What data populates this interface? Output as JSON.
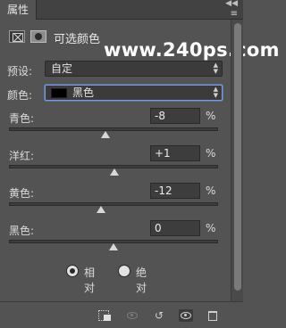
{
  "panel": {
    "tab_label": "属性",
    "collapse_glyph": "◀◀",
    "menu_glyph": "≡"
  },
  "header": {
    "title": "可选颜色",
    "adjustment_icon": "selective-color-icon",
    "mask_icon": "layer-mask-icon"
  },
  "watermark": "www.240ps.com",
  "preset": {
    "label": "预设:",
    "value": "自定"
  },
  "colors": {
    "label": "颜色:",
    "value": "黑色",
    "swatch_color": "#000000"
  },
  "sliders": [
    {
      "label": "青色:",
      "value": "-8",
      "unit": "%",
      "percent": -8
    },
    {
      "label": "洋红:",
      "value": "+1",
      "unit": "%",
      "percent": 1
    },
    {
      "label": "黄色:",
      "value": "-12",
      "unit": "%",
      "percent": -12
    },
    {
      "label": "黑色:",
      "value": "0",
      "unit": "%",
      "percent": 0
    }
  ],
  "method": {
    "options": [
      {
        "label": "相对",
        "checked": true
      },
      {
        "label": "绝对",
        "checked": false
      }
    ]
  },
  "footer": {
    "icons": [
      "clip-to-layer-icon",
      "view-previous-icon",
      "reset-icon",
      "visibility-eye-icon",
      "delete-icon"
    ]
  }
}
